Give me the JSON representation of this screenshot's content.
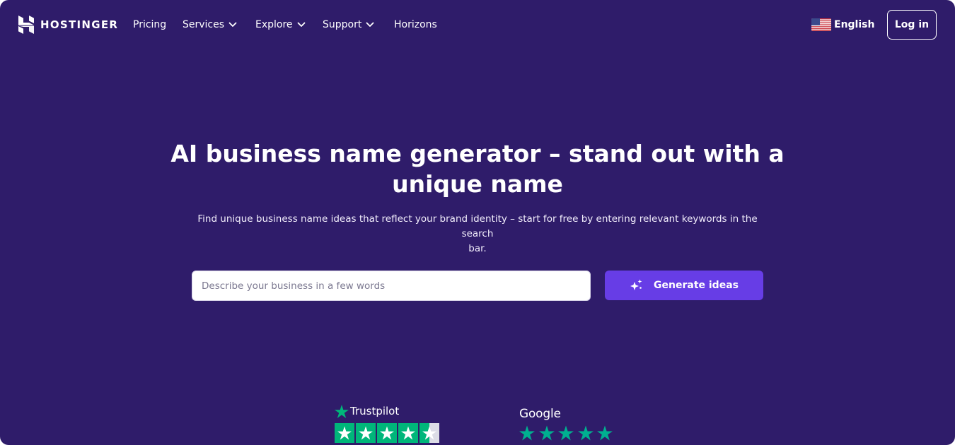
{
  "brand": {
    "name": "HOSTINGER",
    "icon": "hostinger-logo-icon"
  },
  "nav": {
    "items": [
      {
        "label": "Pricing",
        "dropdown": false
      },
      {
        "label": "Services",
        "dropdown": true
      },
      {
        "label": "Explore",
        "dropdown": true
      },
      {
        "label": "Support",
        "dropdown": true
      },
      {
        "label": "Horizons",
        "dropdown": false
      }
    ],
    "language": {
      "label": "English",
      "icon": "us-flag-icon"
    },
    "login_label": "Log in"
  },
  "hero": {
    "title_line1": "AI business name generator – stand out with a",
    "title_line2": "unique name",
    "subtitle_line1": "Find unique business name ideas that reflect your brand identity – start for free by entering relevant keywords in the search",
    "subtitle_line2": "bar.",
    "search": {
      "placeholder": "Describe your business in a few words",
      "value": ""
    },
    "generate_button": {
      "label": "Generate ideas",
      "icon": "sparkle-icon"
    }
  },
  "ratings": {
    "trustpilot": {
      "label": "Trustpilot",
      "stars": 4.5,
      "max": 5
    },
    "google": {
      "label": "Google",
      "stars": 5,
      "max": 5
    }
  },
  "colors": {
    "background": "#2f1c6a",
    "accent": "#673de6",
    "trustpilot_green": "#00b67a",
    "google_star": "#00b090"
  }
}
